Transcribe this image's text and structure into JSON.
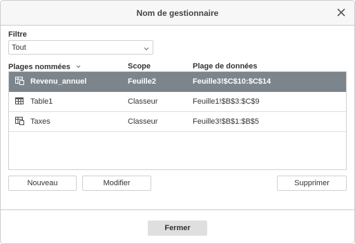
{
  "dialog": {
    "title": "Nom de gestionnaire"
  },
  "filter": {
    "label": "Filtre",
    "selected": "Tout"
  },
  "columns": {
    "name": "Plages nommées",
    "scope": "Scope",
    "range": "Plage de données"
  },
  "rows": [
    {
      "name": "Revenu_annuel",
      "scope": "Feuille2",
      "range": "Feuille3!$C$10:$C$14",
      "icon": "named-range-icon",
      "selected": true
    },
    {
      "name": "Table1",
      "scope": "Classeur",
      "range": "Feuille1!$B$3:$C$9",
      "icon": "table-icon",
      "selected": false
    },
    {
      "name": "Taxes",
      "scope": "Classeur",
      "range": "Feuille3!$B$1:$B$5",
      "icon": "named-range-icon",
      "selected": false
    }
  ],
  "buttons": {
    "new": "Nouveau",
    "edit": "Modifier",
    "delete": "Supprimer",
    "close": "Fermer"
  },
  "colors": {
    "selected_row_bg": "#7d858c",
    "title_bar_bg": "#f7f7f7",
    "close_button_bg": "#dfdfdf"
  }
}
